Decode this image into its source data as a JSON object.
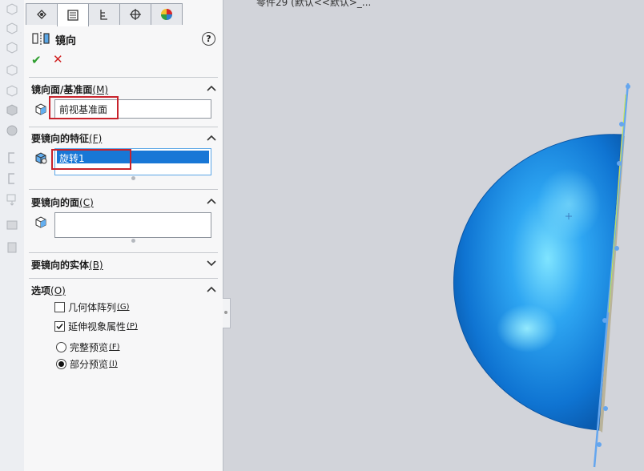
{
  "tabs": [
    {
      "name": "feature-manager-icon"
    },
    {
      "name": "property-manager-icon"
    },
    {
      "name": "configuration-manager-icon"
    },
    {
      "name": "dimxpert-icon"
    },
    {
      "name": "display-manager-icon"
    }
  ],
  "feature": {
    "title": "镜向",
    "help": "?"
  },
  "actions": {
    "ok": "✔",
    "cancel": "✕"
  },
  "sections": {
    "mirror_plane": {
      "title": "镜向面/基准面",
      "mnemonic": "(M)",
      "value": "前视基准面"
    },
    "features": {
      "title": "要镜向的特征",
      "mnemonic": "(F)",
      "items": [
        "旋转1"
      ]
    },
    "faces": {
      "title": "要镜向的面",
      "mnemonic": "(C)",
      "value": ""
    },
    "bodies": {
      "title": "要镜向的实体",
      "mnemonic": "(B)"
    },
    "options": {
      "title": "选项",
      "mnemonic": "(O)",
      "geometry_pattern": {
        "label": "几何体阵列",
        "mnemonic": "(G)",
        "checked": false
      },
      "propagate_visual": {
        "label": "延伸视象属性",
        "mnemonic": "(P)",
        "checked": true
      },
      "full_preview": {
        "label": "完整预览",
        "mnemonic": "(F)",
        "selected": false
      },
      "partial_preview": {
        "label": "部分预览",
        "mnemonic": "(I)",
        "selected": true
      }
    }
  },
  "viewport": {
    "doc_title": "零件29 (默认<<默认>_..."
  },
  "colors": {
    "accent": "#1877d6",
    "highlight": "#c8232c",
    "sphere": "#1a8ce8",
    "ok": "#2e9e2e",
    "cancel": "#d02020"
  }
}
